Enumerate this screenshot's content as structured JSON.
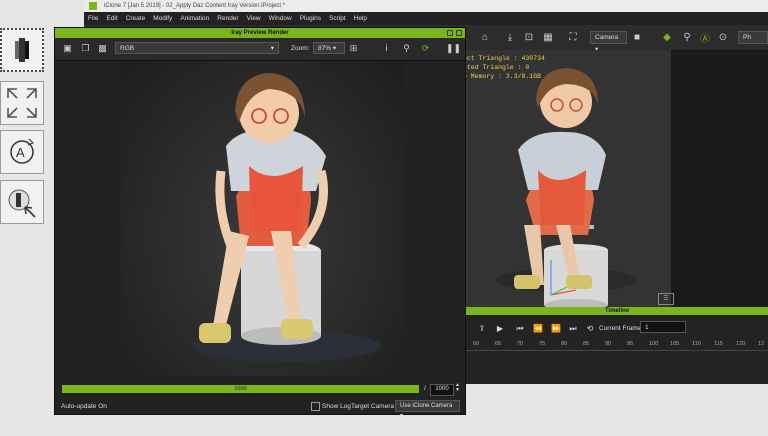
{
  "app": {
    "title": "iClone 7 [Jan  5 2019] - 02_Apply Daz Content Iray Version.iProject *",
    "menu": [
      "File",
      "Edit",
      "Create",
      "Modify",
      "Animation",
      "Render",
      "View",
      "Window",
      "Plugins",
      "Script",
      "Help"
    ],
    "camera_select": "Camera",
    "partial_button": "Ph"
  },
  "viewport": {
    "stats": [
      "ect Triangle : 430734",
      "cted Triangle : 0",
      "o Memory : 3.3/8.1GB"
    ]
  },
  "timeline": {
    "title": "Timeline",
    "current_frame_label": "Current Frame",
    "current_frame_value": "1",
    "ruler": [
      "60",
      "65",
      "70",
      "75",
      "80",
      "85",
      "90",
      "95",
      "100",
      "105",
      "110",
      "115",
      "120",
      "12"
    ]
  },
  "iray": {
    "title": "Iray Preview Render",
    "channel": "RGB",
    "zoom_label": "Zoom:",
    "zoom_value": "87%",
    "progress_value": "1000",
    "max_separator": "/",
    "max_value": "1000",
    "auto_update": "Auto-update On",
    "show_log": "Show Log",
    "target_camera": "Target Camera",
    "camera_option": "Use iClone Camera"
  },
  "colors": {
    "accent": "#7ab51d",
    "stats_text": "#f3d14a"
  },
  "left_tiles": [
    "selection-icon",
    "fit-view-icon",
    "text-rotate-icon",
    "pick-target-icon"
  ]
}
